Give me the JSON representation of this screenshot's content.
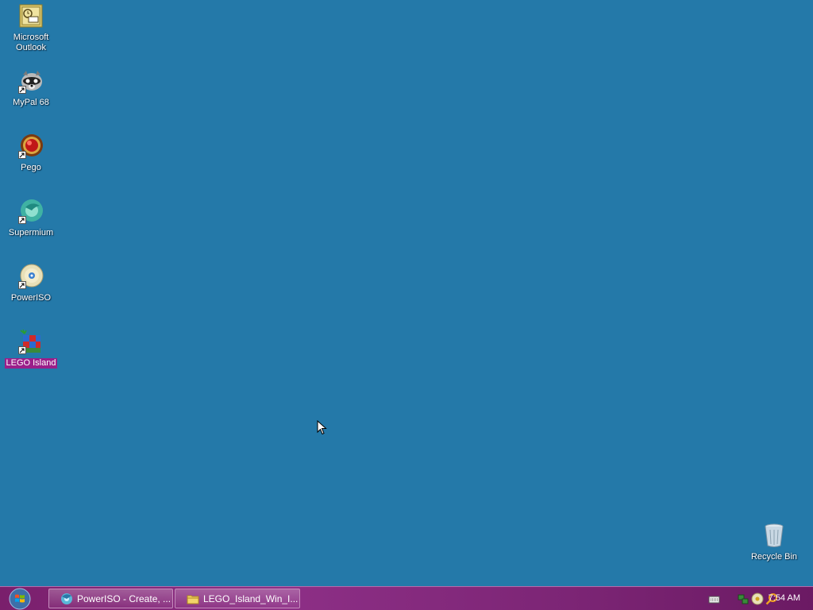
{
  "desktop": {
    "background_color": "#2479a9",
    "icons": [
      {
        "label": "Microsoft\nOutlook",
        "icon": "outlook-icon"
      },
      {
        "label": "MyPal 68",
        "icon": "mypal-raccoon-icon"
      },
      {
        "label": "Pego",
        "icon": "pego-icon"
      },
      {
        "label": "Supermium",
        "icon": "supermium-icon"
      },
      {
        "label": "PowerISO",
        "icon": "poweriso-disc-icon"
      },
      {
        "label": "LEGO Island",
        "icon": "lego-island-icon",
        "selected": true
      },
      {
        "label": "Recycle Bin",
        "icon": "recycle-bin-icon"
      }
    ]
  },
  "taskbar": {
    "color": "#8d2f86",
    "start_button": {
      "icon": "windows-start-orb-icon"
    },
    "buttons": [
      {
        "label": "PowerISO - Create, ...",
        "icon": "poweriso-icon"
      },
      {
        "label": "LEGO_Island_Win_I...",
        "icon": "folder-icon"
      }
    ],
    "tray": {
      "icons": [
        "keyboard-icon",
        "network-icon",
        "disc-icon",
        "search-icon"
      ],
      "clock": "7:54 AM"
    }
  }
}
